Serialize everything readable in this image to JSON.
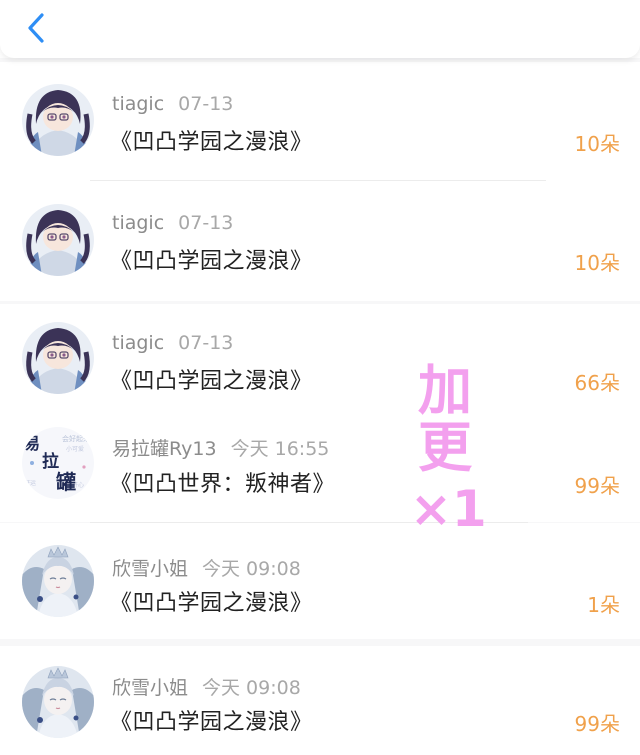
{
  "header": {
    "back_icon": "chevron-left-icon",
    "accent_color": "#2e8ef5"
  },
  "items": [
    {
      "user": "tiagic",
      "time": "07-13",
      "title": "《凹凸学园之漫浪》",
      "amount": "10朵",
      "avatar": "anime-girl-avatar"
    },
    {
      "user": "tiagic",
      "time": "07-13",
      "title": "《凹凸学园之漫浪》",
      "amount": "10朵",
      "avatar": "anime-girl-avatar"
    },
    {
      "user": "tiagic",
      "time": "07-13",
      "title": "《凹凸学园之漫浪》",
      "amount": "66朵",
      "avatar": "anime-girl-avatar"
    },
    {
      "user": "易拉罐Ry13",
      "time": "今天 16:55",
      "title": "《凹凸世界：叛神者》",
      "amount": "99朵",
      "avatar": "calligraphy-avatar",
      "avatar_text": "易拉罐"
    },
    {
      "user": "欣雪小姐",
      "time": "今天 09:08",
      "title": "《凹凸学园之漫浪》",
      "amount": "1朵",
      "avatar": "snow-queen-avatar"
    },
    {
      "user": "欣雪小姐",
      "time": "今天 09:08",
      "title": "《凹凸学园之漫浪》",
      "amount": "99朵",
      "avatar": "snow-queen-avatar"
    }
  ],
  "overlay": {
    "chars": [
      "加",
      "更",
      "×1"
    ],
    "color": "#f3a0ee"
  },
  "colors": {
    "amount": "#f0a14b",
    "meta": "#9a9a9a",
    "title": "#222222"
  }
}
